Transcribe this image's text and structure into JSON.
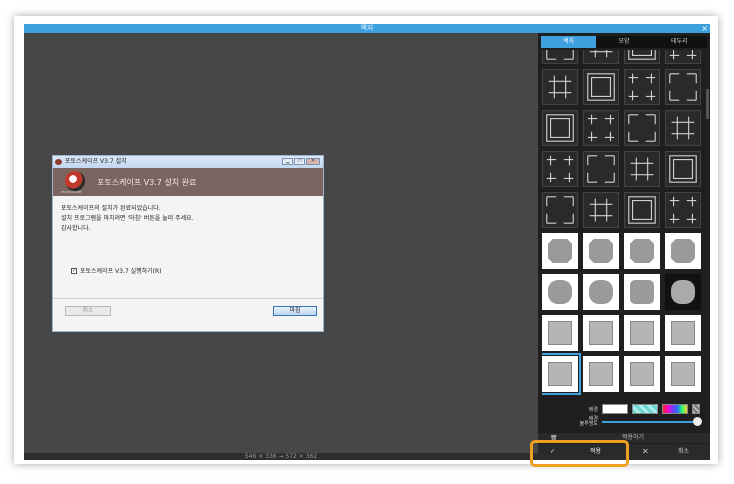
{
  "window": {
    "title": "액자",
    "close_glyph": "×"
  },
  "statusbar": {
    "text": "546 × 336 → 572 × 362"
  },
  "installer": {
    "title": "포토스케이프 V3.7 설치",
    "heading": "포토스케이프 V3.7 설치 완료",
    "logo_caption": "PHOTOSCAPE",
    "body_lines": [
      "포토스케이프의 설치가 완료되었습니다.",
      "설치 프로그램을 마치려면 '마침' 버튼을 눌러 주세요.",
      "감사합니다."
    ],
    "run_checkbox_label": "포토스케이프 V3.7 실행하기(R)",
    "cancel_label": "취소",
    "finish_label": "마침",
    "window_buttons": [
      "▁",
      "▭",
      "✕"
    ]
  },
  "panel": {
    "tabs": [
      {
        "label": "액자",
        "active": true
      },
      {
        "label": "모양",
        "active": false
      },
      {
        "label": "테두리",
        "active": false
      }
    ],
    "background_label": "배경",
    "transparency_label": "배경\n불투명도",
    "transparency_value": 1.0,
    "apply_all_label": "적용하기",
    "trash_icon": "trash-icon",
    "apply_label": "적용",
    "apply_check": "✓",
    "cancel_label": "취소",
    "cancel_x": "✕"
  },
  "colors": {
    "accent": "#3fa0e0",
    "highlight": "#f0a020"
  }
}
